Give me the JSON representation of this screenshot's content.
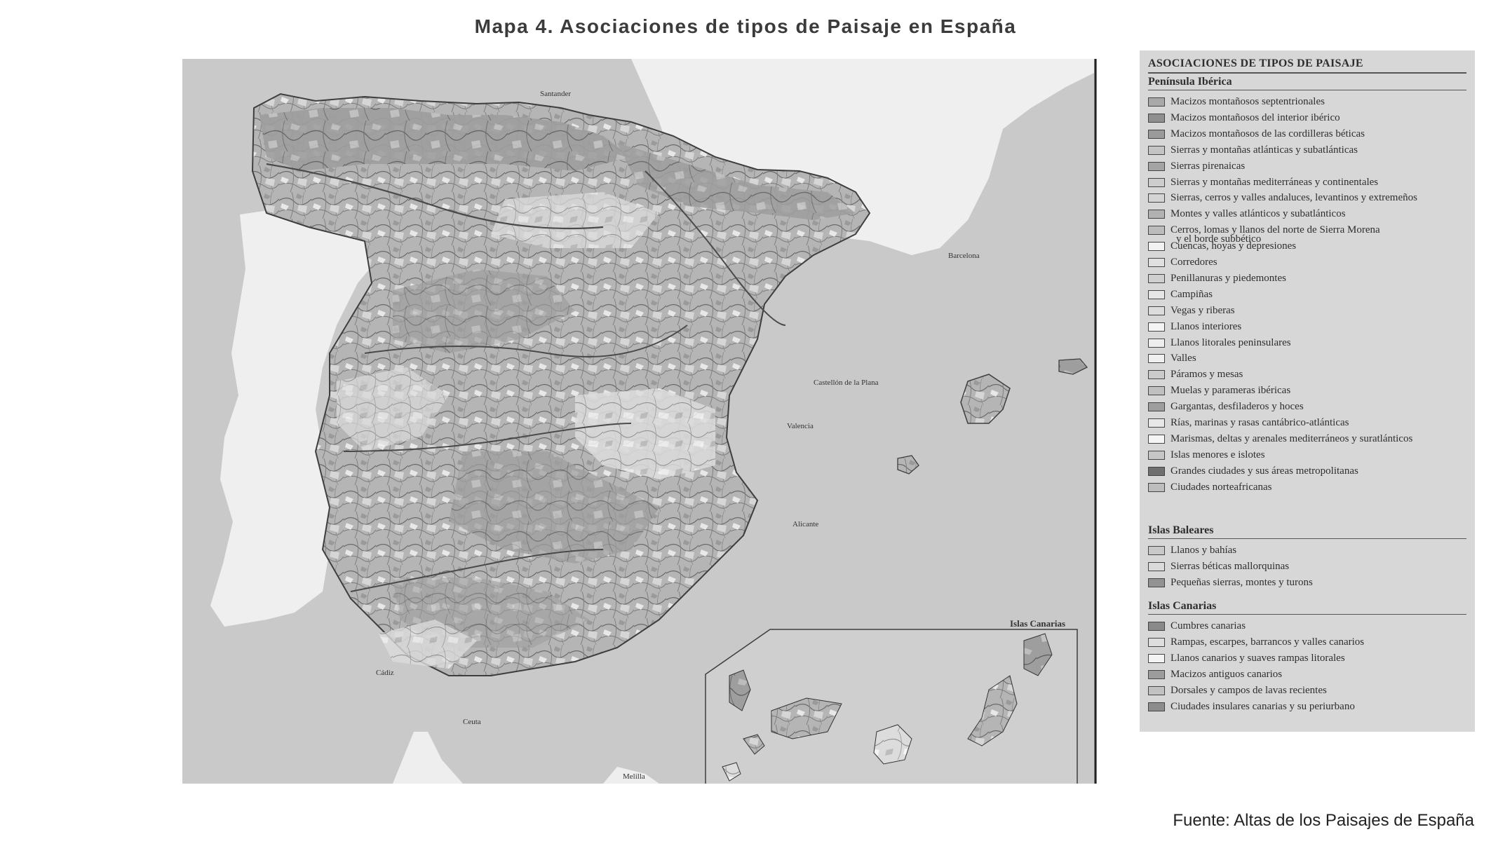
{
  "title": "Mapa 4. Asociaciones de tipos de Paisaje en España",
  "source": "Fuente: Altas de los Paisajes de España",
  "map": {
    "inset_title": "Islas Canarias",
    "place_labels": [
      "Santander",
      "Barcelona",
      "Castellón de la Plana",
      "Valencia",
      "Alicante",
      "Cádiz",
      "Ceuta",
      "Melilla"
    ]
  },
  "legend": {
    "title": "ASOCIACIONES DE TIPOS DE PAISAJE",
    "sections": [
      {
        "title": "Península Ibérica",
        "items": [
          {
            "label": "Macizos montañosos septentrionales",
            "color": "#a8a8a8"
          },
          {
            "label": "Macizos montañosos del interior ibérico",
            "color": "#8f8f8f"
          },
          {
            "label": "Macizos montañosos de las cordilleras béticas",
            "color": "#9a9a9a"
          },
          {
            "label": "Sierras y montañas atlánticas y subatlánticas",
            "color": "#c4c4c4"
          },
          {
            "label": "Sierras pirenaicas",
            "color": "#a4a4a4"
          },
          {
            "label": "Sierras y montañas mediterráneas y continentales",
            "color": "#cdcdcd"
          },
          {
            "label": "Sierras, cerros y valles andaluces, levantinos y extremeños",
            "color": "#d4d4d4"
          },
          {
            "label": "Montes y valles atlánticos y subatlánticos",
            "color": "#b2b2b2"
          },
          {
            "label": "Cerros, lomas y llanos del norte de Sierra Morena",
            "color": "#bcbcbc"
          },
          {
            "label": "y el borde subbético",
            "color": ""
          },
          {
            "label": "Cuencas, hoyas y depresiones",
            "color": "#f2f2f2"
          },
          {
            "label": "Corredores",
            "color": "#e0e0e0"
          },
          {
            "label": "Penillanuras y piedemontes",
            "color": "#cfcfcf"
          },
          {
            "label": "Campiñas",
            "color": "#e6e6e6"
          },
          {
            "label": "Vegas y riberas",
            "color": "#dcdcdc"
          },
          {
            "label": "Llanos interiores",
            "color": "#f4f4f4"
          },
          {
            "label": "Llanos litorales peninsulares",
            "color": "#eeeeee"
          },
          {
            "label": "Valles",
            "color": "#f0f0f0"
          },
          {
            "label": "Páramos y mesas",
            "color": "#cbcbcb"
          },
          {
            "label": "Muelas y parameras ibéricas",
            "color": "#c0c0c0"
          },
          {
            "label": "Gargantas, desfiladeros y hoces",
            "color": "#9e9e9e"
          },
          {
            "label": "Rías, marinas y rasas cantábrico-atlánticas",
            "color": "#e8e8e8"
          },
          {
            "label": "Marismas, deltas y arenales mediterráneos y suratlánticos",
            "color": "#f5f5f5"
          },
          {
            "label": "Islas menores e islotes",
            "color": "#c6c6c6"
          },
          {
            "label": "Grandes ciudades y sus áreas metropolitanas",
            "color": "#6f6f6f"
          },
          {
            "label": "Ciudades norteafricanas",
            "color": "#bdbdbd"
          }
        ]
      },
      {
        "title": "Islas Baleares",
        "items": [
          {
            "label": "Llanos y bahías",
            "color": "#c8c8c8"
          },
          {
            "label": "Sierras béticas mallorquinas",
            "color": "#dadada"
          },
          {
            "label": "Pequeñas sierras, montes y turons",
            "color": "#929292"
          }
        ]
      },
      {
        "title": "Islas Canarias",
        "items": [
          {
            "label": "Cumbres canarias",
            "color": "#8a8a8a"
          },
          {
            "label": "Rampas, escarpes, barrancos y valles canarios",
            "color": "#dedede"
          },
          {
            "label": "Llanos canarios y suaves rampas litorales",
            "color": "#f3f3f3"
          },
          {
            "label": "Macizos antiguos canarios",
            "color": "#9c9c9c"
          },
          {
            "label": "Dorsales y campos de lavas recientes",
            "color": "#c2c2c2"
          },
          {
            "label": "Ciudades insulares canarias y su periurbano",
            "color": "#8d8d8d"
          }
        ]
      }
    ]
  }
}
